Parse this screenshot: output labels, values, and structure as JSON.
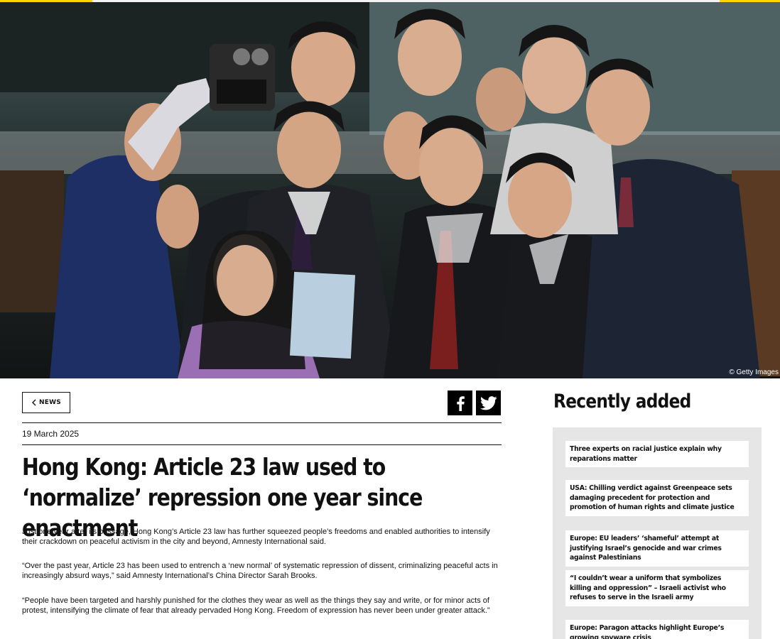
{
  "hero": {
    "credit": "© Getty Images"
  },
  "nav": {
    "back_label": "NEWS"
  },
  "share": {
    "facebook_icon": "facebook-icon",
    "twitter_icon": "twitter-icon"
  },
  "article": {
    "date": "19 March 2025",
    "title": "Hong Kong: Article 23 law used to ‘normalize’ repression one year since enactment",
    "paragraphs": [
      "Just one year after its passage, Hong Kong’s Article 23 law has further squeezed people’s freedoms and enabled authorities to intensify their crackdown on peaceful activism in the city and beyond, Amnesty International said.",
      "“Over the past year, Article 23 has been used to entrench a ‘new normal’ of systematic repression of dissent, criminalizing peaceful acts in increasingly absurd ways,” said Amnesty International’s China Director Sarah Brooks.",
      "“People have been targeted and harshly punished for the clothes they wear as well as the things they say and write, or for minor acts of protest, intensifying the climate of fear that already pervaded Hong Kong. Freedom of expression has never been under greater attack.”"
    ]
  },
  "recently_added": {
    "heading": "Recently added",
    "items": [
      "Three experts on racial justice explain why reparations matter",
      "USA: Chilling verdict against Greenpeace sets damaging precedent for protection and promotion of human rights and climate justice",
      "Europe: EU leaders’ ‘shameful’ attempt at justifying Israel’s genocide and war crimes against Palestinians",
      "“I couldn’t wear a uniform that symbolizes killing and oppression” – Israeli activist who refuses to serve in the Israeli army",
      "Europe: Paragon attacks highlight Europe’s growing spyware crisis"
    ]
  },
  "colors": {
    "accent_yellow": "#ffd500",
    "text": "#111111",
    "panel_bg": "#e6e6e6"
  }
}
